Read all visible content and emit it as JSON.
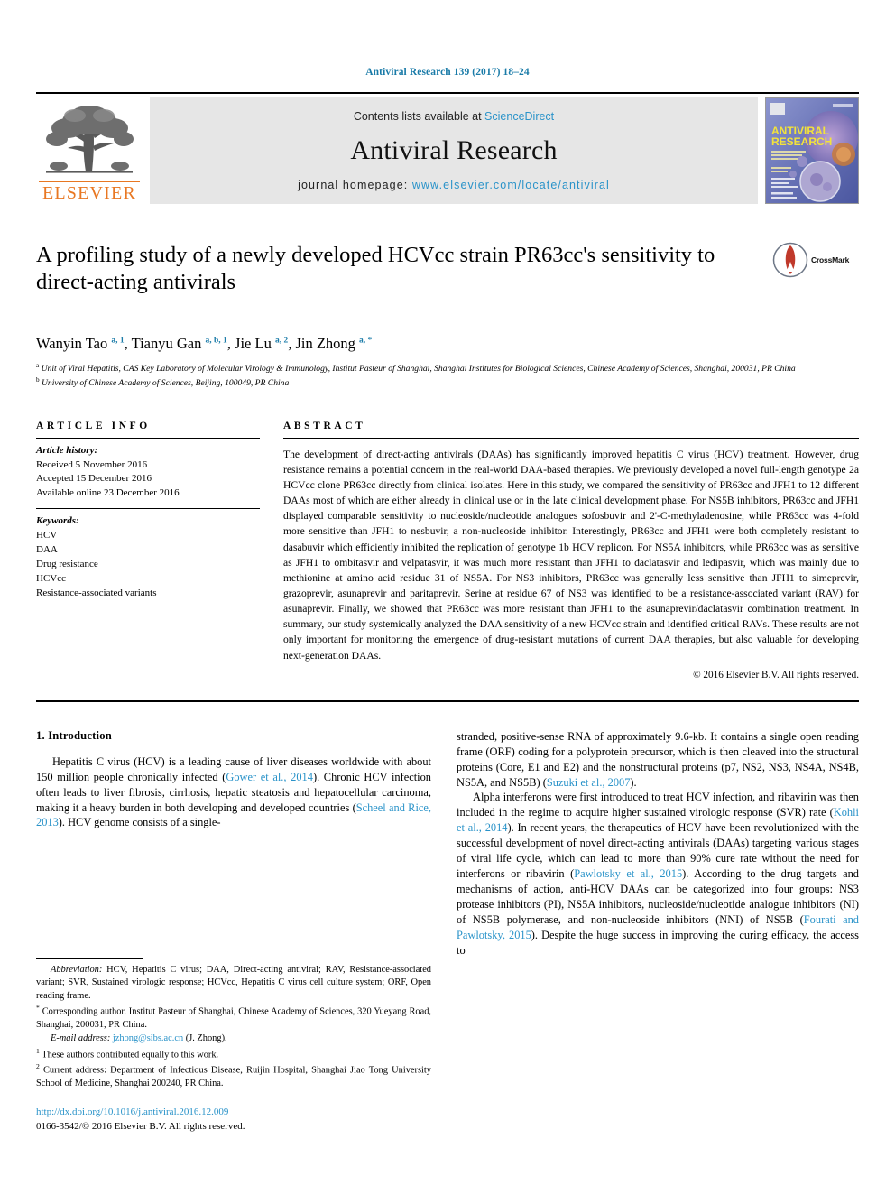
{
  "running_head": "Antiviral Research 139 (2017) 18–24",
  "masthead": {
    "publisher_name": "ELSEVIER",
    "contents_prefix": "Contents lists available at ",
    "contents_link": "ScienceDirect",
    "journal_name": "Antiviral Research",
    "homepage_prefix": "journal homepage: ",
    "homepage_url": "www.elsevier.com/locate/antiviral",
    "cover_title_line1": "ANTIVIRAL",
    "cover_title_line2": "RESEARCH"
  },
  "title": "A profiling study of a newly developed HCVcc strain PR63cc's sensitivity to direct-acting antivirals",
  "crossmark_label": "CrossMark",
  "authors_html": "Wanyin Tao <sup>a, 1</sup>, Tianyu Gan <sup>a, b, 1</sup>, Jie Lu <sup>a, 2</sup>, Jin Zhong <sup>a, *</sup>",
  "affiliations": [
    "Unit of Viral Hepatitis, CAS Key Laboratory of Molecular Virology & Immunology, Institut Pasteur of Shanghai, Shanghai Institutes for Biological Sciences, Chinese Academy of Sciences, Shanghai, 200031, PR China",
    "University of Chinese Academy of Sciences, Beijing, 100049, PR China"
  ],
  "article_info": {
    "heading": "ARTICLE INFO",
    "history_label": "Article history:",
    "history": [
      "Received 5 November 2016",
      "Accepted 15 December 2016",
      "Available online 23 December 2016"
    ],
    "keywords_label": "Keywords:",
    "keywords": [
      "HCV",
      "DAA",
      "Drug resistance",
      "HCVcc",
      "Resistance-associated variants"
    ]
  },
  "abstract": {
    "heading": "ABSTRACT",
    "text": "The development of direct-acting antivirals (DAAs) has significantly improved hepatitis C virus (HCV) treatment. However, drug resistance remains a potential concern in the real-world DAA-based therapies. We previously developed a novel full-length genotype 2a HCVcc clone PR63cc directly from clinical isolates. Here in this study, we compared the sensitivity of PR63cc and JFH1 to 12 different DAAs most of which are either already in clinical use or in the late clinical development phase. For NS5B inhibitors, PR63cc and JFH1 displayed comparable sensitivity to nucleoside/nucleotide analogues sofosbuvir and 2'-C-methyladenosine, while PR63cc was 4-fold more sensitive than JFH1 to nesbuvir, a non-nucleoside inhibitor. Interestingly, PR63cc and JFH1 were both completely resistant to dasabuvir which efficiently inhibited the replication of genotype 1b HCV replicon. For NS5A inhibitors, while PR63cc was as sensitive as JFH1 to ombitasvir and velpatasvir, it was much more resistant than JFH1 to daclatasvir and ledipasvir, which was mainly due to methionine at amino acid residue 31 of NS5A. For NS3 inhibitors, PR63cc was generally less sensitive than JFH1 to simeprevir, grazoprevir, asunaprevir and paritaprevir. Serine at residue 67 of NS3 was identified to be a resistance-associated variant (RAV) for asunaprevir. Finally, we showed that PR63cc was more resistant than JFH1 to the asunaprevir/daclatasvir combination treatment. In summary, our study systemically analyzed the DAA sensitivity of a new HCVcc strain and identified critical RAVs. These results are not only important for monitoring the emergence of drug-resistant mutations of current DAA therapies, but also valuable for developing next-generation DAAs.",
    "copyright": "© 2016 Elsevier B.V. All rights reserved."
  },
  "introduction": {
    "heading": "1. Introduction",
    "left_paragraph_1_pre": "Hepatitis C virus (HCV) is a leading cause of liver diseases worldwide with about 150 million people chronically infected (",
    "left_ref_1": "Gower et al., 2014",
    "left_paragraph_1_mid": "). Chronic HCV infection often leads to liver fibrosis, cirrhosis, hepatic steatosis and hepatocellular carcinoma, making it a heavy burden in both developing and developed countries (",
    "left_ref_2": "Scheel and Rice, 2013",
    "left_paragraph_1_post": "). HCV genome consists of a single-",
    "right_paragraph_1_pre": "stranded, positive-sense RNA of approximately 9.6-kb. It contains a single open reading frame (ORF) coding for a polyprotein precursor, which is then cleaved into the structural proteins (Core, E1 and E2) and the nonstructural proteins (p7, NS2, NS3, NS4A, NS4B, NS5A, and NS5B) (",
    "right_ref_1": "Suzuki et al., 2007",
    "right_paragraph_1_post": ").",
    "right_paragraph_2_pre": "Alpha interferons were first introduced to treat HCV infection, and ribavirin was then included in the regime to acquire higher sustained virologic response (SVR) rate (",
    "right_ref_2": "Kohli et al., 2014",
    "right_paragraph_2_mid1": "). In recent years, the therapeutics of HCV have been revolutionized with the successful development of novel direct-acting antivirals (DAAs) targeting various stages of viral life cycle, which can lead to more than 90% cure rate without the need for interferons or ribavirin (",
    "right_ref_3": "Pawlotsky et al., 2015",
    "right_paragraph_2_mid2": "). According to the drug targets and mechanisms of action, anti-HCV DAAs can be categorized into four groups: NS3 protease inhibitors (PI), NS5A inhibitors, nucleoside/nucleotide analogue inhibitors (NI) of NS5B polymerase, and non-nucleoside inhibitors (NNI) of NS5B (",
    "right_ref_4": "Fourati and Pawlotsky, 2015",
    "right_paragraph_2_post": "). Despite the huge success in improving the curing efficacy, the access to"
  },
  "footnotes": {
    "abbrev_label": "Abbreviation:",
    "abbrev_text": " HCV, Hepatitis C virus; DAA, Direct-acting antiviral; RAV, Resistance-associated variant; SVR, Sustained virologic response; HCVcc, Hepatitis C virus cell culture system; ORF, Open reading frame.",
    "corresponding": "Corresponding author. Institut Pasteur of Shanghai, Chinese Academy of Sciences, 320 Yueyang Road, Shanghai, 200031, PR China.",
    "email_label": "E-mail address:",
    "email": "jzhong@sibs.ac.cn",
    "email_suffix": " (J. Zhong).",
    "note1": "These authors contributed equally to this work.",
    "note2": "Current address: Department of Infectious Disease, Ruijin Hospital, Shanghai Jiao Tong University School of Medicine, Shanghai 200240, PR China."
  },
  "doi": {
    "url": "http://dx.doi.org/10.1016/j.antiviral.2016.12.009",
    "issn_line": "0166-3542/© 2016 Elsevier B.V. All rights reserved."
  },
  "colors": {
    "link": "#2a93c9",
    "runhead": "#1a7ba8",
    "elsevier_orange": "#E87722",
    "masthead_bg": "#e6e6e6"
  }
}
